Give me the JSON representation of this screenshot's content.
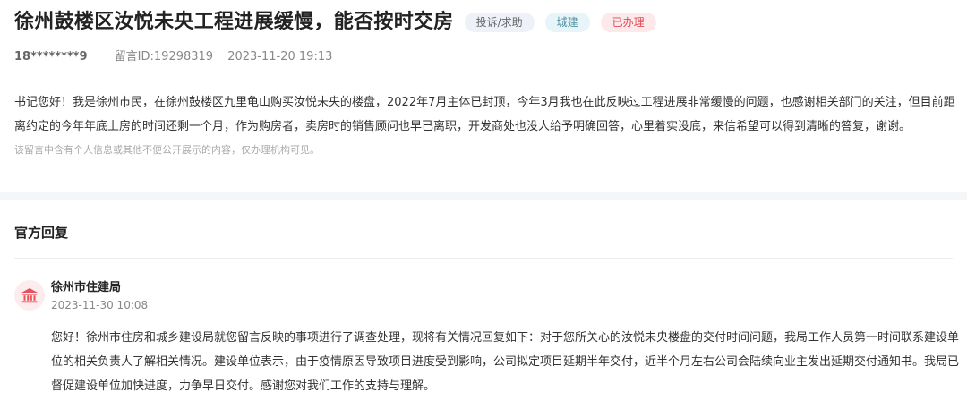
{
  "header": {
    "title": "徐州鼓楼区汝悦未央工程进展缓慢，能否按时交房",
    "tags": [
      {
        "label": "投诉/求助"
      },
      {
        "label": "城建"
      },
      {
        "label": "已办理"
      }
    ]
  },
  "meta": {
    "phone": "18********9",
    "message_id": "留言ID:19298319",
    "datetime": "2023-11-20 19:13"
  },
  "message": {
    "content": "书记您好！我是徐州市民，在徐州鼓楼区九里龟山购买汝悦未央的楼盘，2022年7月主体已封顶，今年3月我也在此反映过工程进展非常缓慢的问题，也感谢相关部门的关注，但目前距离约定的今年年底上房的时间还剩一个月，作为购房者，卖房时的销售顾问也早已离职，开发商处也没人给予明确回答，心里着实没底，来信希望可以得到清晰的答复，谢谢。",
    "privacy_note": "该留言中含有个人信息或其他不便公开展示的内容，仅办理机构可见。"
  },
  "reply": {
    "section_title": "官方回复",
    "org_name": "徐州市住建局",
    "datetime": "2023-11-30 10:08",
    "content": "您好！徐州市住房和城乡建设局就您留言反映的事项进行了调查处理，现将有关情况回复如下：对于您所关心的汝悦未央楼盘的交付时间问题，我局工作人员第一时间联系建设单位的相关负责人了解相关情况。建设单位表示，由于疫情原因导致项目进度受到影响，公司拟定项目延期半年交付，近半个月左右公司会陆续向业主发出延期交付通知书。我局已督促建设单位加快进度，力争早日交付。感谢您对我们工作的支持与理解。",
    "avatar_icon": "government-building-icon"
  },
  "colors": {
    "tag_status": "#e24b56",
    "tag_field": "#4f8fa3",
    "avatar_bg": "#fdecee",
    "avatar_icon": "#e8505b"
  }
}
